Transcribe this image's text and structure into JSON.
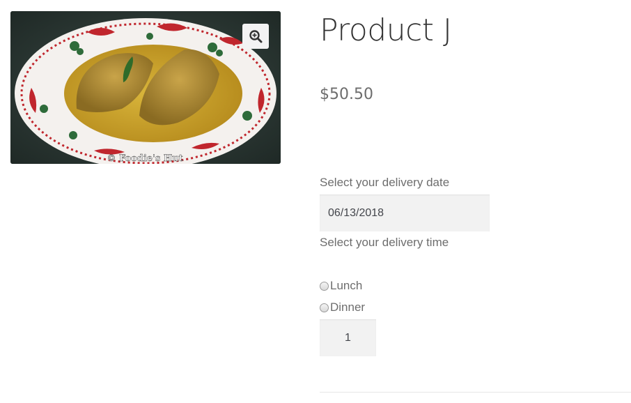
{
  "gallery": {
    "image_alt": "Fish curry on a decorative plate",
    "watermark": "© Foodie's Hut",
    "zoom_icon": "zoom-in-icon"
  },
  "product": {
    "title": "Product J",
    "price": "$50.50"
  },
  "delivery": {
    "date_label": "Select your delivery date",
    "date_value": "06/13/2018",
    "time_label": "Select your delivery time",
    "options": [
      "Lunch",
      "Dinner"
    ]
  },
  "quantity": {
    "value": "1"
  }
}
